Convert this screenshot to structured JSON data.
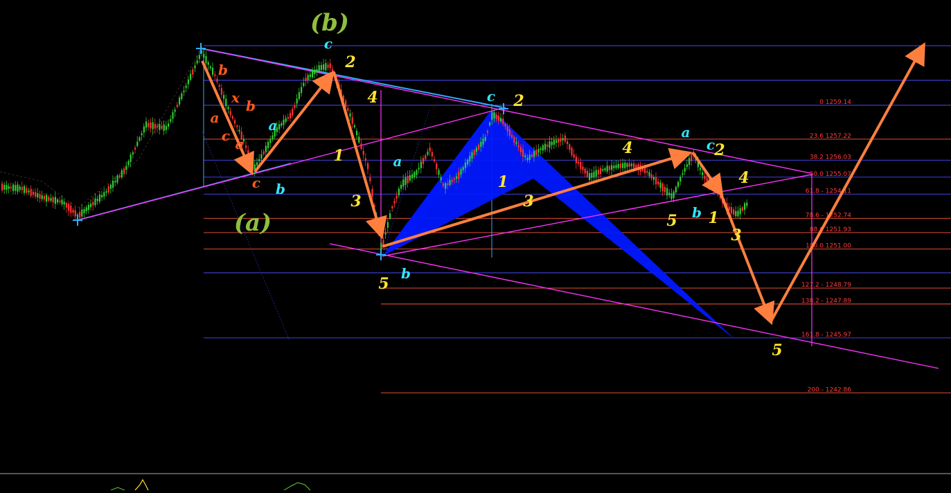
{
  "chart_data": {
    "type": "candlestick",
    "title": "",
    "xlabel": "",
    "ylabel": "",
    "grid": false,
    "background": "#000000",
    "colors": {
      "bull": "#33cc33",
      "bear": "#ff3333",
      "fib_blue": "#4a4aff",
      "fib_red": "#ff5a3a",
      "channel": "#ff33ff",
      "trendline": "#33aaff",
      "wave_arrow": "#ff7f3f",
      "harmonic": "#0018ff",
      "label_yellow": "#ffe533",
      "label_cyan": "#33e5ff",
      "label_orange": "#ff5a1e",
      "label_green": "#8fbf3f"
    },
    "fib_levels": [
      {
        "ratio": "0",
        "price": "1259.14",
        "text": "0 1259.14",
        "price_value": 1259.14,
        "color": "blue"
      },
      {
        "ratio": "23.6",
        "price": "1257.22",
        "text": "23.6 1257.22",
        "price_value": 1257.22,
        "color": "red"
      },
      {
        "ratio": "38.2",
        "price": "1256.03",
        "text": "38.2 1256.03",
        "price_value": 1256.03,
        "color": "blue"
      },
      {
        "ratio": "50.0",
        "price": "1255.07",
        "text": "50.0 1255.07",
        "price_value": 1255.07,
        "color": "blue"
      },
      {
        "ratio": "61.8",
        "price": "1254.11",
        "text": "61.8 - 1254.11",
        "price_value": 1254.11,
        "color": "blue"
      },
      {
        "ratio": "78.6",
        "price": "1252.74",
        "text": "78.6 - 1252.74",
        "price_value": 1252.74,
        "color": "red"
      },
      {
        "ratio": "88.6",
        "price": "1251.93",
        "text": "88.6 1251.93",
        "price_value": 1251.93,
        "color": "red"
      },
      {
        "ratio": "100.0",
        "price": "1251.00",
        "text": "100.0 1251.00",
        "price_value": 1251.0,
        "color": "red"
      },
      {
        "ratio": "127.2",
        "price": "1248.79",
        "text": "127.2 - 1248.79",
        "price_value": 1248.79,
        "color": "red"
      },
      {
        "ratio": "138.2",
        "price": "1247.89",
        "text": "138.2 - 1247.89",
        "price_value": 1247.89,
        "color": "red"
      },
      {
        "ratio": "161.8",
        "price": "1245.97",
        "text": "161.8 - 1245.97",
        "price_value": 1245.97,
        "color": "blue"
      },
      {
        "ratio": "200",
        "price": "1242.86",
        "text": "200 - 1242.86",
        "price_value": 1242.86,
        "color": "red"
      }
    ],
    "wave_labels": [
      {
        "text": "(b)",
        "color": "green",
        "size": 34
      },
      {
        "text": "(a)",
        "color": "green",
        "size": 34
      },
      {
        "text": "b",
        "color": "orange",
        "size": 20
      },
      {
        "text": "a",
        "color": "orange",
        "size": 20
      },
      {
        "text": "x",
        "color": "orange",
        "size": 20
      },
      {
        "text": "b",
        "color": "orange",
        "size": 20
      },
      {
        "text": "c",
        "color": "orange",
        "size": 20
      },
      {
        "text": "a",
        "color": "orange",
        "size": 20
      },
      {
        "text": "c",
        "color": "orange",
        "size": 20
      },
      {
        "text": "b",
        "color": "cyan",
        "size": 20
      },
      {
        "text": "a",
        "color": "cyan",
        "size": 20
      },
      {
        "text": "c",
        "color": "cyan",
        "size": 20
      },
      {
        "text": "2",
        "color": "yellow",
        "size": 22
      },
      {
        "text": "4",
        "color": "yellow",
        "size": 22
      },
      {
        "text": "1",
        "color": "yellow",
        "size": 22
      },
      {
        "text": "3",
        "color": "yellow",
        "size": 22
      },
      {
        "text": "5",
        "color": "yellow",
        "size": 22
      },
      {
        "text": "b",
        "color": "cyan",
        "size": 20
      },
      {
        "text": "a",
        "color": "cyan",
        "size": 20
      },
      {
        "text": "c",
        "color": "cyan",
        "size": 20
      },
      {
        "text": "2",
        "color": "yellow",
        "size": 22
      },
      {
        "text": "1",
        "color": "yellow",
        "size": 22
      },
      {
        "text": "3",
        "color": "yellow",
        "size": 22
      },
      {
        "text": "4",
        "color": "yellow",
        "size": 22
      },
      {
        "text": "a",
        "color": "cyan",
        "size": 20
      },
      {
        "text": "c",
        "color": "cyan",
        "size": 20
      },
      {
        "text": "2",
        "color": "yellow",
        "size": 22
      },
      {
        "text": "4",
        "color": "yellow",
        "size": 22
      },
      {
        "text": "5",
        "color": "yellow",
        "size": 22
      },
      {
        "text": "b",
        "color": "cyan",
        "size": 20
      },
      {
        "text": "1",
        "color": "yellow",
        "size": 22
      },
      {
        "text": "3",
        "color": "yellow",
        "size": 22
      },
      {
        "text": "5",
        "color": "yellow",
        "size": 22
      }
    ]
  }
}
